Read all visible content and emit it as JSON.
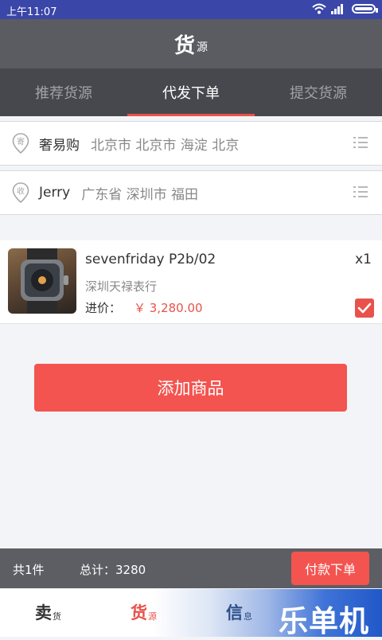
{
  "status": {
    "time": "上午11:07"
  },
  "header": {
    "title_main": "货",
    "title_sub": "源"
  },
  "tabs": [
    {
      "label": "推荐货源"
    },
    {
      "label": "代发下单"
    },
    {
      "label": "提交货源"
    }
  ],
  "sender": {
    "badge": "寄",
    "name": "奢易购",
    "place": "北京市 北京市 海淀 北京"
  },
  "receiver": {
    "badge": "收",
    "name": "Jerry",
    "place": "广东省 深圳市 福田"
  },
  "product": {
    "name": "sevenfriday P2b/02",
    "quantity": "x1",
    "shop": "深圳天禄表行",
    "price_label": "进价：",
    "price": "￥ 3,280.00",
    "checked": true
  },
  "actions": {
    "add_product": "添加商品"
  },
  "footer": {
    "count": "共1件",
    "total": "总计：3280",
    "pay_button": "付款下单"
  },
  "nav": [
    {
      "big": "卖",
      "small": "货",
      "color": "#333333"
    },
    {
      "big": "货",
      "small": "源",
      "color": "#e8524a"
    },
    {
      "big": "信",
      "small": "息",
      "color": "#2d4f8a"
    }
  ],
  "watermark": "乐单机",
  "colors": {
    "accent": "#e8524a",
    "header": "#5b5c62",
    "tabs": "#47484e",
    "status": "#3a46a8"
  }
}
